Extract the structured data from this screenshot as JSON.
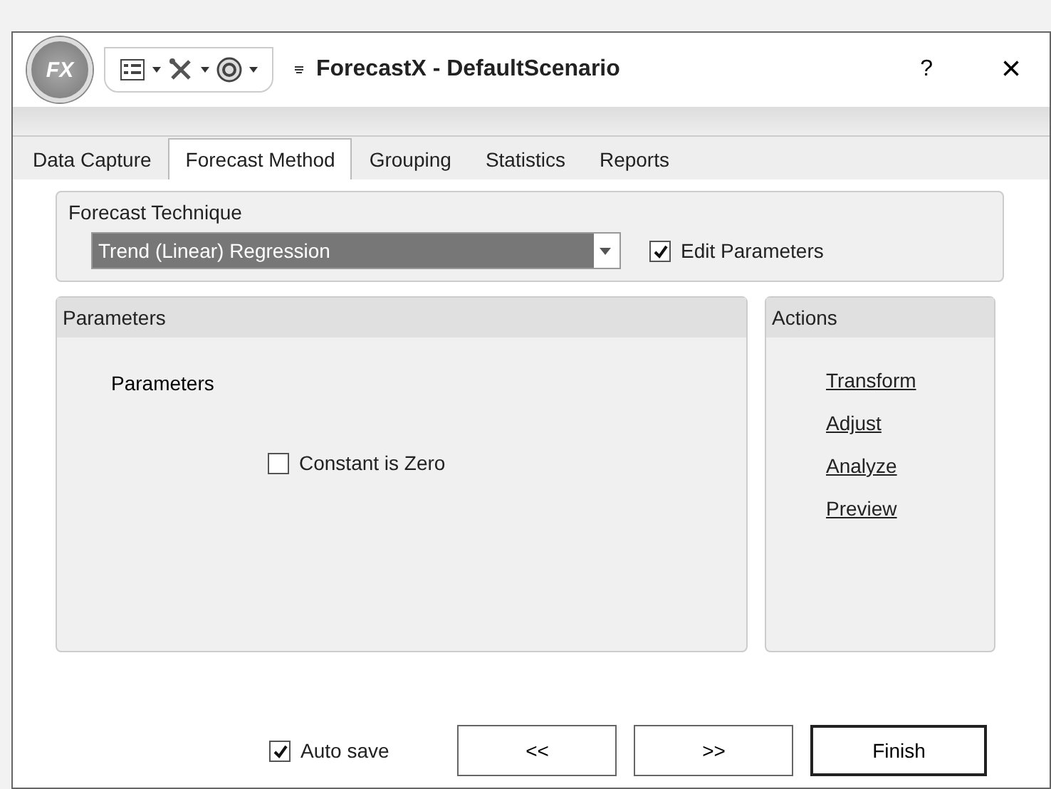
{
  "window": {
    "title": "ForecastX - DefaultScenario",
    "logo": "FX",
    "help": "?",
    "close": "×"
  },
  "tabs": [
    {
      "label": "Data Capture",
      "selected": false
    },
    {
      "label": "Forecast Method",
      "selected": true
    },
    {
      "label": "Grouping",
      "selected": false
    },
    {
      "label": "Statistics",
      "selected": false
    },
    {
      "label": "Reports",
      "selected": false
    }
  ],
  "technique": {
    "title": "Forecast Technique",
    "value": "Trend (Linear) Regression",
    "edit_parameters": {
      "label": "Edit Parameters",
      "checked": true
    }
  },
  "parameters": {
    "title": "Parameters",
    "label": "Parameters",
    "constant_is_zero": {
      "label": "Constant is Zero",
      "checked": false
    }
  },
  "actions": {
    "title": "Actions",
    "links": [
      "Transform",
      "Adjust",
      "Analyze",
      "Preview"
    ]
  },
  "footer": {
    "auto_save": {
      "label": "Auto save",
      "checked": true
    },
    "buttons": [
      {
        "label": "<<",
        "default": false
      },
      {
        "label": ">>",
        "default": false
      },
      {
        "label": "Finish",
        "default": true
      }
    ]
  }
}
